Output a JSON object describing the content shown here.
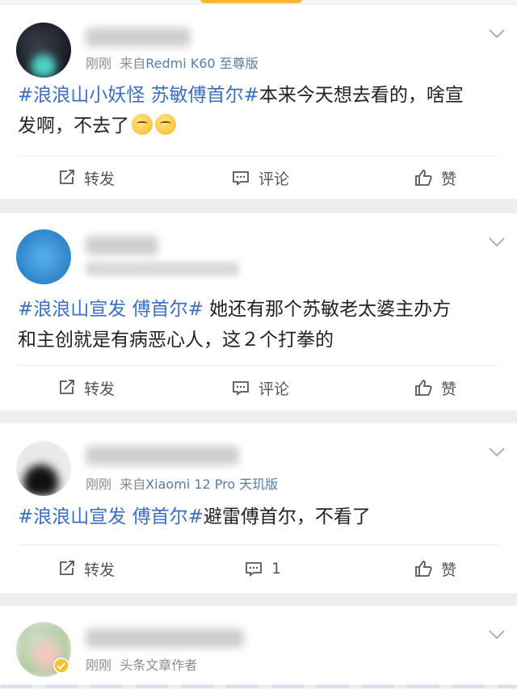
{
  "colors": {
    "hashtag": "#3a6fc4",
    "source": "#5b7aa6",
    "meta": "#8c8c8c",
    "text": "#222222",
    "background": "#eeeeee",
    "card": "#ffffff"
  },
  "posts": [
    {
      "time": "刚刚",
      "source_prefix": "来自",
      "source": "Redmi K60 至尊版",
      "hashtag": "#浪浪山小妖怪 苏敏傅首尔#",
      "text_line1": "本来今天想去看的，啥宣",
      "text_line2": "发啊，不去了",
      "emoji": [
        "grimace-emoji",
        "grimace-emoji"
      ],
      "actions": {
        "repost": "转发",
        "comment": "评论",
        "like": "赞"
      }
    },
    {
      "hashtag": "#浪浪山宣发 傅首尔#",
      "text_line1": " 她还有那个苏敏老太婆主办方",
      "text_line2": "和主创就是有病恶心人，这２个打拳的",
      "actions": {
        "repost": "转发",
        "comment": "评论",
        "like": "赞"
      }
    },
    {
      "time": "刚刚",
      "source_prefix": "来自",
      "source": "Xiaomi 12 Pro 天玑版",
      "hashtag": "#浪浪山宣发 傅首尔#",
      "text_line1": "避雷傅首尔，不看了",
      "actions": {
        "repost": "转发",
        "comment": "1",
        "like": "赞"
      }
    },
    {
      "time": "刚刚",
      "badge_text": "头条文章作者"
    }
  ],
  "icons": {
    "repost": "repost-icon",
    "comment": "comment-icon",
    "like": "thumbs-up-icon",
    "more": "chevron-down-icon",
    "verified": "verified-badge-icon"
  }
}
